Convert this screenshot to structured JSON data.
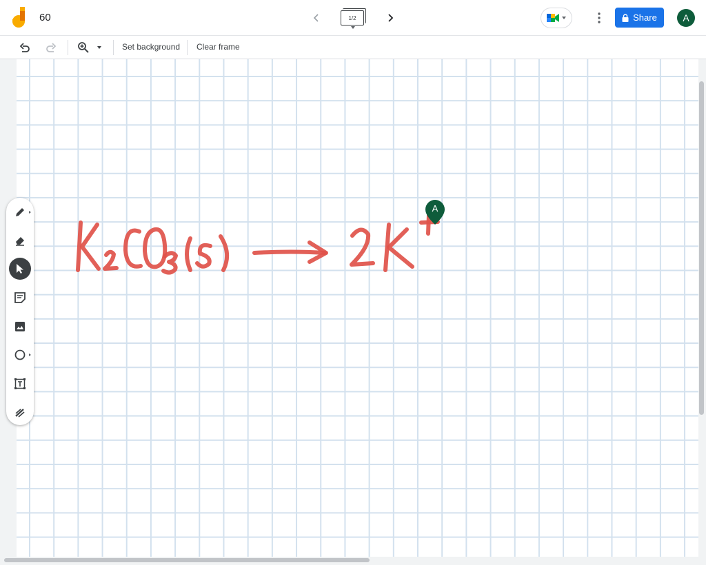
{
  "app": {
    "title": "60"
  },
  "frame_nav": {
    "indicator": "1/2"
  },
  "header": {
    "share_label": "Share",
    "avatar_initial": "A"
  },
  "toolbar": {
    "set_background_label": "Set background",
    "clear_frame_label": "Clear frame"
  },
  "canvas": {
    "collaborator_initial": "A",
    "ink_color": "#e0524a",
    "handwriting": "K2CO3 (s) → 2K+"
  },
  "side_tools": [
    "pen-tool",
    "eraser-tool",
    "select-tool",
    "sticky-note-tool",
    "image-tool",
    "shape-tool",
    "text-box-tool",
    "laser-tool"
  ],
  "colors": {
    "accent": "#1a73e8",
    "avatar": "#0e5c3b",
    "grid": "#d3e1ee"
  }
}
